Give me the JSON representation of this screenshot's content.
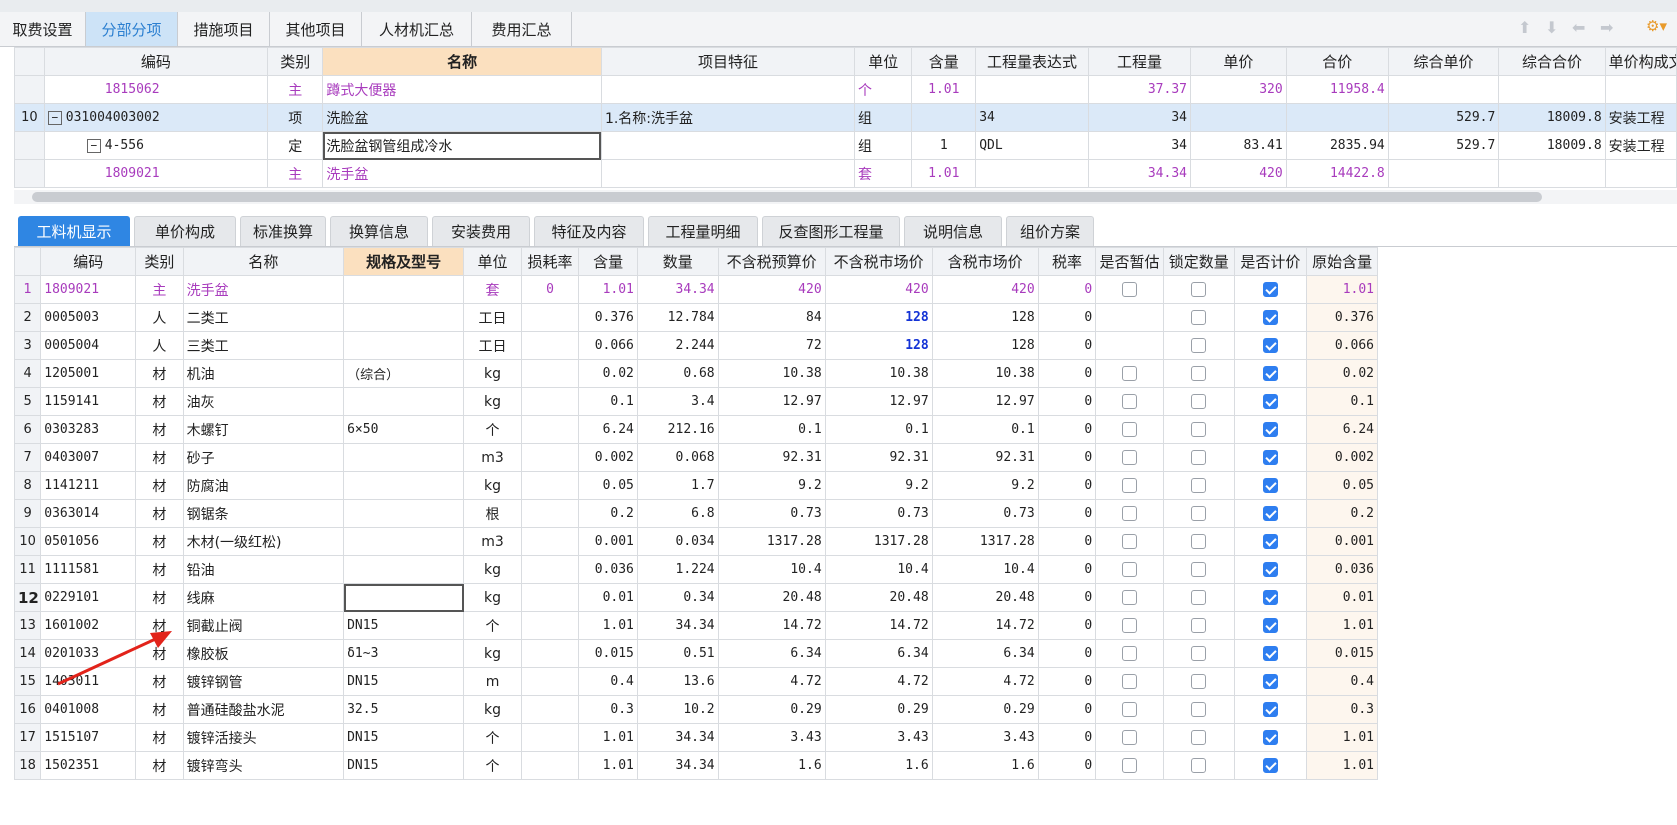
{
  "main_tabs": [
    "取费设置",
    "分部分项",
    "措施项目",
    "其他项目",
    "人材机汇总",
    "费用汇总"
  ],
  "main_active": 1,
  "top_table": {
    "headers": [
      "编码",
      "类别",
      "名称",
      "项目特征",
      "单位",
      "含量",
      "工程量表达式",
      "工程量",
      "单价",
      "合价",
      "综合单价",
      "综合合价",
      "单价构成文件"
    ],
    "rows": [
      {
        "no": "",
        "code": "1815062",
        "type": "主",
        "name": "蹲式大便器",
        "feature": "",
        "unit": "个",
        "content": "1.01",
        "expr": "",
        "qty": "37.37",
        "price": "320",
        "total": "11958.4",
        "uprice": "",
        "utotal": "",
        "file": ""
      },
      {
        "no": "10",
        "code": "031004003002",
        "type": "项",
        "name": "洗脸盆",
        "feature": "1.名称:洗手盆",
        "unit": "组",
        "content": "",
        "expr": "34",
        "qty": "34",
        "price": "",
        "total": "",
        "uprice": "529.7",
        "utotal": "18009.8",
        "file": "安装工程"
      },
      {
        "no": "",
        "code": "4-556",
        "type": "定",
        "name": "洗脸盆钢管组成冷水",
        "feature": "",
        "unit": "组",
        "content": "1",
        "expr": "QDL",
        "qty": "34",
        "price": "83.41",
        "total": "2835.94",
        "uprice": "529.7",
        "utotal": "18009.8",
        "file": "安装工程"
      },
      {
        "no": "",
        "code": "1809021",
        "type": "主",
        "name": "洗手盆",
        "feature": "",
        "unit": "套",
        "content": "1.01",
        "expr": "",
        "qty": "34.34",
        "price": "420",
        "total": "14422.8",
        "uprice": "",
        "utotal": "",
        "file": ""
      }
    ]
  },
  "sub_tabs": [
    "工料机显示",
    "单价构成",
    "标准换算",
    "换算信息",
    "安装费用",
    "特征及内容",
    "工程量明细",
    "反查图形工程量",
    "说明信息",
    "组价方案"
  ],
  "sub_active": 0,
  "bottom_table": {
    "headers": [
      "编码",
      "类别",
      "名称",
      "规格及型号",
      "单位",
      "损耗率",
      "含量",
      "数量",
      "不含税预算价",
      "不含税市场价",
      "含税市场价",
      "税率",
      "是否暂估",
      "锁定数量",
      "是否计价",
      "原始含量"
    ],
    "rows": [
      {
        "no": "1",
        "code": "1809021",
        "type": "主",
        "name": "洗手盆",
        "spec": "",
        "unit": "套",
        "loss": "0",
        "content": "1.01",
        "qty": "34.34",
        "budget": "420",
        "market": "420",
        "taxmarket": "420",
        "tax": "0",
        "est": "box",
        "lock": false,
        "priced": true,
        "orig": "1.01",
        "purple": true
      },
      {
        "no": "2",
        "code": "0005003",
        "type": "人",
        "name": "二类工",
        "spec": "",
        "unit": "工日",
        "loss": "",
        "content": "0.376",
        "qty": "12.784",
        "budget": "84",
        "market": "128",
        "taxmarket": "128",
        "tax": "0",
        "est": "none",
        "lock": false,
        "priced": true,
        "orig": "0.376",
        "blue": true
      },
      {
        "no": "3",
        "code": "0005004",
        "type": "人",
        "name": "三类工",
        "spec": "",
        "unit": "工日",
        "loss": "",
        "content": "0.066",
        "qty": "2.244",
        "budget": "72",
        "market": "128",
        "taxmarket": "128",
        "tax": "0",
        "est": "none",
        "lock": false,
        "priced": true,
        "orig": "0.066",
        "blue": true
      },
      {
        "no": "4",
        "code": "1205001",
        "type": "材",
        "name": "机油",
        "spec": "（综合）",
        "unit": "kg",
        "loss": "",
        "content": "0.02",
        "qty": "0.68",
        "budget": "10.38",
        "market": "10.38",
        "taxmarket": "10.38",
        "tax": "0",
        "est": "box",
        "lock": false,
        "priced": true,
        "orig": "0.02"
      },
      {
        "no": "5",
        "code": "1159141",
        "type": "材",
        "name": "油灰",
        "spec": "",
        "unit": "kg",
        "loss": "",
        "content": "0.1",
        "qty": "3.4",
        "budget": "12.97",
        "market": "12.97",
        "taxmarket": "12.97",
        "tax": "0",
        "est": "box",
        "lock": false,
        "priced": true,
        "orig": "0.1"
      },
      {
        "no": "6",
        "code": "0303283",
        "type": "材",
        "name": "木螺钉",
        "spec": "6×50",
        "unit": "个",
        "loss": "",
        "content": "6.24",
        "qty": "212.16",
        "budget": "0.1",
        "market": "0.1",
        "taxmarket": "0.1",
        "tax": "0",
        "est": "box",
        "lock": false,
        "priced": true,
        "orig": "6.24"
      },
      {
        "no": "7",
        "code": "0403007",
        "type": "材",
        "name": "砂子",
        "spec": "",
        "unit": "m3",
        "loss": "",
        "content": "0.002",
        "qty": "0.068",
        "budget": "92.31",
        "market": "92.31",
        "taxmarket": "92.31",
        "tax": "0",
        "est": "box",
        "lock": false,
        "priced": true,
        "orig": "0.002"
      },
      {
        "no": "8",
        "code": "1141211",
        "type": "材",
        "name": "防腐油",
        "spec": "",
        "unit": "kg",
        "loss": "",
        "content": "0.05",
        "qty": "1.7",
        "budget": "9.2",
        "market": "9.2",
        "taxmarket": "9.2",
        "tax": "0",
        "est": "box",
        "lock": false,
        "priced": true,
        "orig": "0.05"
      },
      {
        "no": "9",
        "code": "0363014",
        "type": "材",
        "name": "钢锯条",
        "spec": "",
        "unit": "根",
        "loss": "",
        "content": "0.2",
        "qty": "6.8",
        "budget": "0.73",
        "market": "0.73",
        "taxmarket": "0.73",
        "tax": "0",
        "est": "box",
        "lock": false,
        "priced": true,
        "orig": "0.2"
      },
      {
        "no": "10",
        "code": "0501056",
        "type": "材",
        "name": "木材(一级红松)",
        "spec": "",
        "unit": "m3",
        "loss": "",
        "content": "0.001",
        "qty": "0.034",
        "budget": "1317.28",
        "market": "1317.28",
        "taxmarket": "1317.28",
        "tax": "0",
        "est": "box",
        "lock": false,
        "priced": true,
        "orig": "0.001"
      },
      {
        "no": "11",
        "code": "1111581",
        "type": "材",
        "name": "铅油",
        "spec": "",
        "unit": "kg",
        "loss": "",
        "content": "0.036",
        "qty": "1.224",
        "budget": "10.4",
        "market": "10.4",
        "taxmarket": "10.4",
        "tax": "0",
        "est": "box",
        "lock": false,
        "priced": true,
        "orig": "0.036"
      },
      {
        "no": "12",
        "code": "0229101",
        "type": "材",
        "name": "线麻",
        "spec": "",
        "unit": "kg",
        "loss": "",
        "content": "0.01",
        "qty": "0.34",
        "budget": "20.48",
        "market": "20.48",
        "taxmarket": "20.48",
        "tax": "0",
        "est": "box",
        "lock": false,
        "priced": true,
        "orig": "0.01",
        "current": true
      },
      {
        "no": "13",
        "code": "1601002",
        "type": "材",
        "name": "铜截止阀",
        "spec": "DN15",
        "unit": "个",
        "loss": "",
        "content": "1.01",
        "qty": "34.34",
        "budget": "14.72",
        "market": "14.72",
        "taxmarket": "14.72",
        "tax": "0",
        "est": "box",
        "lock": false,
        "priced": true,
        "orig": "1.01"
      },
      {
        "no": "14",
        "code": "0201033",
        "type": "材",
        "name": "橡胶板",
        "spec": "δ1~3",
        "unit": "kg",
        "loss": "",
        "content": "0.015",
        "qty": "0.51",
        "budget": "6.34",
        "market": "6.34",
        "taxmarket": "6.34",
        "tax": "0",
        "est": "box",
        "lock": false,
        "priced": true,
        "orig": "0.015"
      },
      {
        "no": "15",
        "code": "1403011",
        "type": "材",
        "name": "镀锌钢管",
        "spec": "DN15",
        "unit": "m",
        "loss": "",
        "content": "0.4",
        "qty": "13.6",
        "budget": "4.72",
        "market": "4.72",
        "taxmarket": "4.72",
        "tax": "0",
        "est": "box",
        "lock": false,
        "priced": true,
        "orig": "0.4"
      },
      {
        "no": "16",
        "code": "0401008",
        "type": "材",
        "name": "普通硅酸盐水泥",
        "spec": "32.5",
        "unit": "kg",
        "loss": "",
        "content": "0.3",
        "qty": "10.2",
        "budget": "0.29",
        "market": "0.29",
        "taxmarket": "0.29",
        "tax": "0",
        "est": "box",
        "lock": false,
        "priced": true,
        "orig": "0.3"
      },
      {
        "no": "17",
        "code": "1515107",
        "type": "材",
        "name": "镀锌活接头",
        "spec": "DN15",
        "unit": "个",
        "loss": "",
        "content": "1.01",
        "qty": "34.34",
        "budget": "3.43",
        "market": "3.43",
        "taxmarket": "3.43",
        "tax": "0",
        "est": "box",
        "lock": false,
        "priced": true,
        "orig": "1.01"
      },
      {
        "no": "18",
        "code": "1502351",
        "type": "材",
        "name": "镀锌弯头",
        "spec": "DN15",
        "unit": "个",
        "loss": "",
        "content": "1.01",
        "qty": "34.34",
        "budget": "1.6",
        "market": "1.6",
        "taxmarket": "1.6",
        "tax": "0",
        "est": "box",
        "lock": false,
        "priced": true,
        "orig": "1.01"
      }
    ]
  },
  "colors": {
    "accent": "#2f86e3",
    "purple": "#a83bbd",
    "arrow": "#e2231a",
    "highlight_header": "#fbe0bf"
  }
}
